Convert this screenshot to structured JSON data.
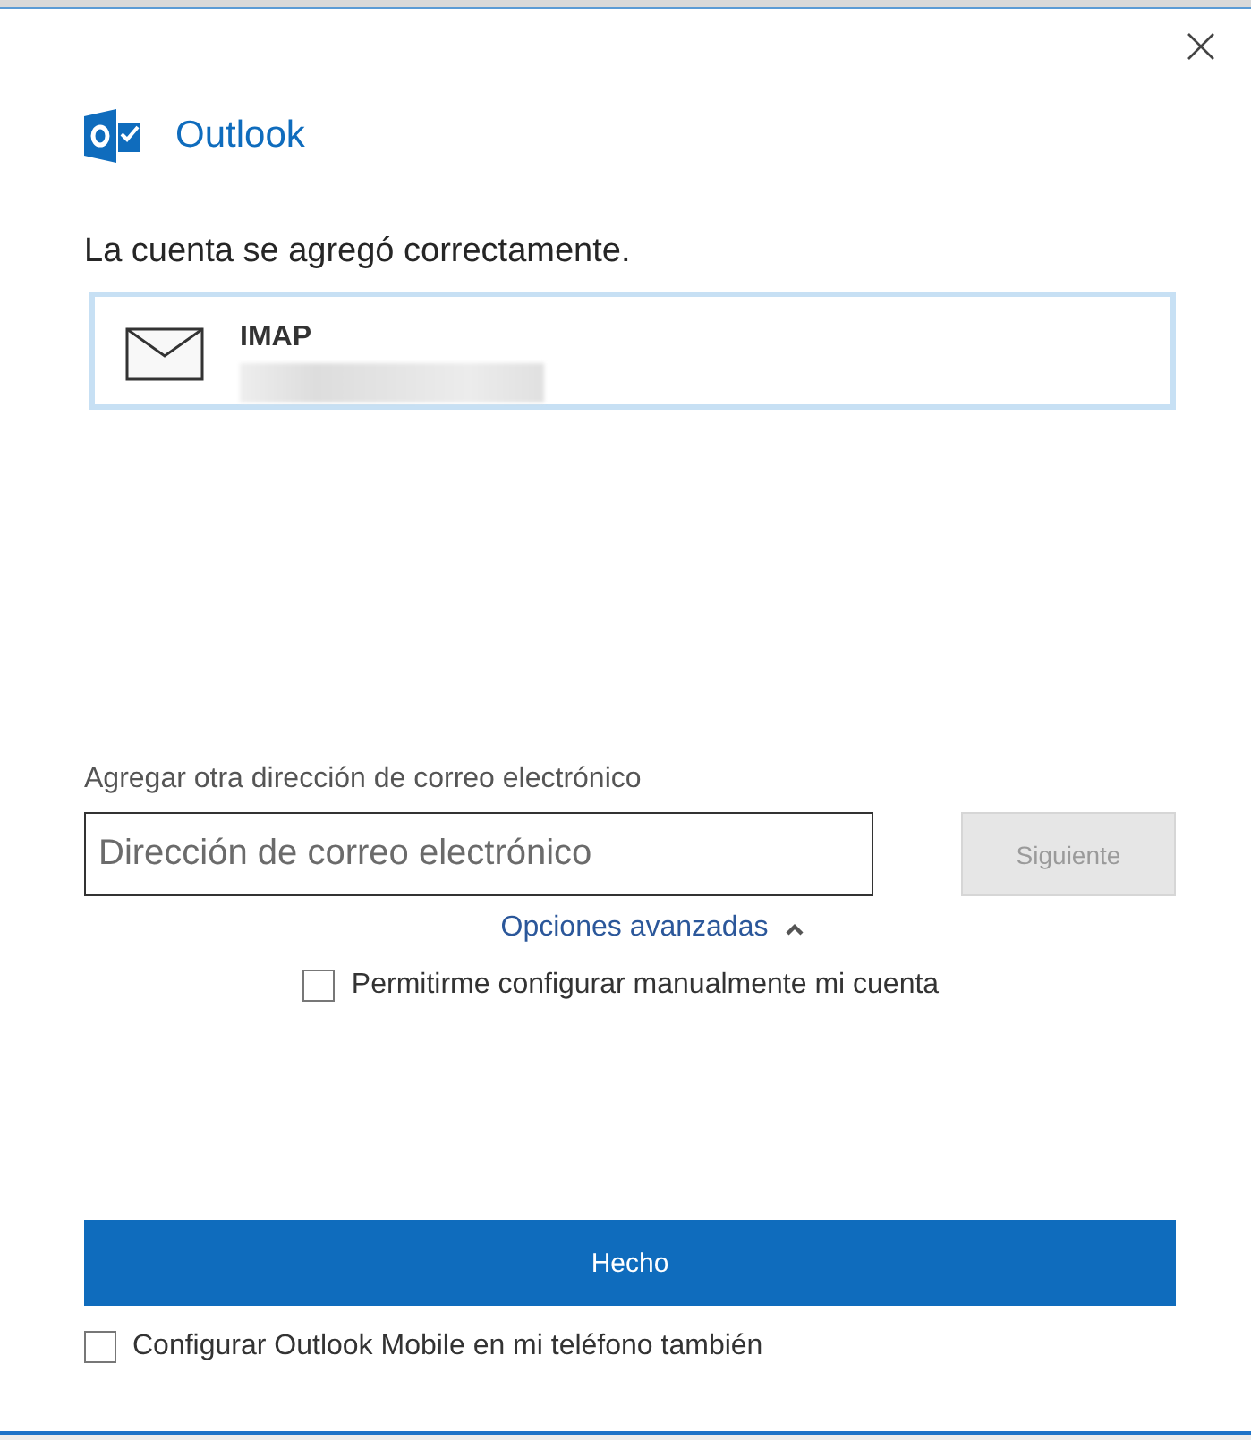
{
  "window": {
    "app_name": "Outlook"
  },
  "heading": "La cuenta se agregó correctamente.",
  "account": {
    "type": "IMAP"
  },
  "add_email": {
    "label": "Agregar otra dirección de correo electrónico",
    "placeholder": "Dirección de correo electrónico",
    "next_button": {
      "label": "Siguiente",
      "disabled": true
    }
  },
  "advanced_options": {
    "label": "Opciones avanzadas",
    "expanded": true
  },
  "manual_setup": {
    "label": "Permitirme configurar manualmente mi cuenta",
    "checked": false
  },
  "done_button": "Hecho",
  "mobile_setup": {
    "label": "Configurar Outlook Mobile en mi teléfono también",
    "checked": false
  }
}
